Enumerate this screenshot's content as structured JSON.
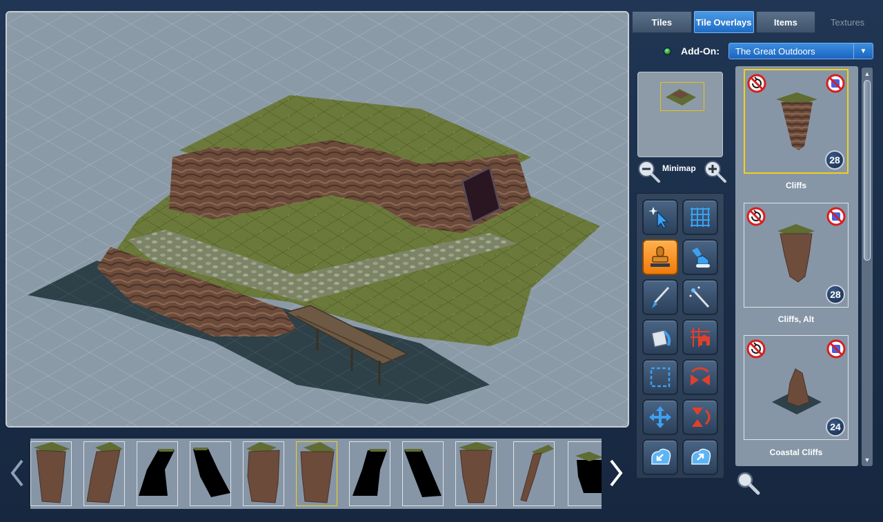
{
  "tabs": [
    {
      "label": "Tiles",
      "active": false,
      "disabled": false
    },
    {
      "label": "Tile Overlays",
      "active": true,
      "disabled": false
    },
    {
      "label": "Items",
      "active": false,
      "disabled": false
    },
    {
      "label": "Textures",
      "active": false,
      "disabled": true
    }
  ],
  "addon": {
    "label": "Add-On:",
    "selected": "The Great Outdoors",
    "status": "active"
  },
  "minimap": {
    "label": "Minimap"
  },
  "tools": [
    {
      "name": "select-tool",
      "icon": "cursor-sparkle-icon",
      "active": false
    },
    {
      "name": "grid-tool",
      "icon": "grid-icon",
      "active": false
    },
    {
      "name": "stamp-tool",
      "icon": "stamp-icon",
      "active": true
    },
    {
      "name": "excavator-tool",
      "icon": "excavator-icon",
      "active": false
    },
    {
      "name": "brush-tool",
      "icon": "brush-icon",
      "active": false
    },
    {
      "name": "magic-wand-tool",
      "icon": "magic-wand-icon",
      "active": false
    },
    {
      "name": "fill-bucket-tool",
      "icon": "paint-bucket-icon",
      "active": false
    },
    {
      "name": "grid-house-tool",
      "icon": "grid-house-icon",
      "active": false
    },
    {
      "name": "marquee-tool",
      "icon": "marquee-select-icon",
      "active": false
    },
    {
      "name": "flip-horizontal-tool",
      "icon": "flip-horizontal-icon",
      "active": false
    },
    {
      "name": "move-tool",
      "icon": "move-arrows-icon",
      "active": false
    },
    {
      "name": "flip-vertical-tool",
      "icon": "flip-vertical-icon",
      "active": false
    },
    {
      "name": "import-tool",
      "icon": "import-icon",
      "active": false
    },
    {
      "name": "export-tool",
      "icon": "export-icon",
      "active": false
    }
  ],
  "assets": [
    {
      "label": "Cliffs",
      "count": "28",
      "selected": true
    },
    {
      "label": "Cliffs, Alt",
      "count": "28",
      "selected": false
    },
    {
      "label": "Coastal Cliffs",
      "count": "24",
      "selected": false
    }
  ],
  "filmstrip": {
    "thumbnails": [
      {
        "kind": "cliff",
        "selected": false
      },
      {
        "kind": "cliff",
        "selected": false
      },
      {
        "kind": "shadow",
        "selected": false
      },
      {
        "kind": "shadow",
        "selected": false
      },
      {
        "kind": "cliff",
        "selected": false
      },
      {
        "kind": "cliff",
        "selected": true
      },
      {
        "kind": "shadow",
        "selected": false
      },
      {
        "kind": "shadow",
        "selected": false
      },
      {
        "kind": "cliff",
        "selected": false
      },
      {
        "kind": "cliff-thin",
        "selected": false
      },
      {
        "kind": "shadow-partial",
        "selected": false
      }
    ]
  },
  "colors": {
    "accent": "#1f6cc5",
    "selection": "#f1d21b",
    "grass": "#6b7a38",
    "water": "#2d3f48",
    "rock": "#6a4a3a",
    "tool_active": "#f07a0a"
  }
}
